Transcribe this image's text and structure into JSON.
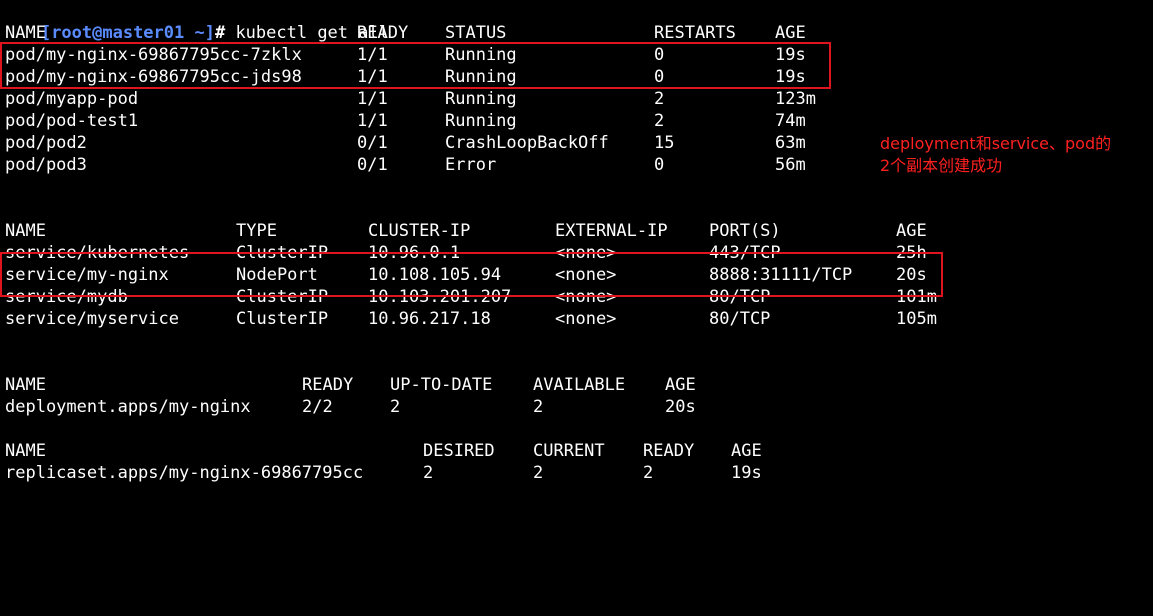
{
  "prompt": {
    "user_host": "[root@master01 ~]",
    "symbol": "# ",
    "command": "kubectl get all"
  },
  "pods": {
    "headers": [
      "NAME",
      "READY",
      "STATUS",
      "RESTARTS",
      "AGE"
    ],
    "rows": [
      [
        "pod/my-nginx-69867795cc-7zklx",
        "1/1",
        "Running",
        "0",
        "19s"
      ],
      [
        "pod/my-nginx-69867795cc-jds98",
        "1/1",
        "Running",
        "0",
        "19s"
      ],
      [
        "pod/myapp-pod",
        "1/1",
        "Running",
        "2",
        "123m"
      ],
      [
        "pod/pod-test1",
        "1/1",
        "Running",
        "2",
        "74m"
      ],
      [
        "pod/pod2",
        "0/1",
        "CrashLoopBackOff",
        "15",
        "63m"
      ],
      [
        "pod/pod3",
        "0/1",
        "Error",
        "0",
        "56m"
      ]
    ]
  },
  "services": {
    "headers": [
      "NAME",
      "TYPE",
      "CLUSTER-IP",
      "EXTERNAL-IP",
      "PORT(S)",
      "AGE"
    ],
    "rows": [
      [
        "service/kubernetes",
        "ClusterIP",
        "10.96.0.1",
        "<none>",
        "443/TCP",
        "25h"
      ],
      [
        "service/my-nginx",
        "NodePort",
        "10.108.105.94",
        "<none>",
        "8888:31111/TCP",
        "20s"
      ],
      [
        "service/mydb",
        "ClusterIP",
        "10.103.201.207",
        "<none>",
        "80/TCP",
        "101m"
      ],
      [
        "service/myservice",
        "ClusterIP",
        "10.96.217.18",
        "<none>",
        "80/TCP",
        "105m"
      ]
    ]
  },
  "deployments": {
    "headers": [
      "NAME",
      "READY",
      "UP-TO-DATE",
      "AVAILABLE",
      "AGE"
    ],
    "rows": [
      [
        "deployment.apps/my-nginx",
        "2/2",
        "2",
        "2",
        "20s"
      ]
    ]
  },
  "replicasets": {
    "headers": [
      "NAME",
      "DESIRED",
      "CURRENT",
      "READY",
      "AGE"
    ],
    "rows": [
      [
        "replicaset.apps/my-nginx-69867795cc",
        "2",
        "2",
        "2",
        "19s"
      ]
    ]
  },
  "annotation": {
    "line1": "deployment和service、pod的",
    "line2": "2个副本创建成功"
  },
  "colors": {
    "background": "#000000",
    "text": "#ffffff",
    "prompt": "#5b8cff",
    "highlight": "#e0141e",
    "annotation": "#ff2020"
  }
}
